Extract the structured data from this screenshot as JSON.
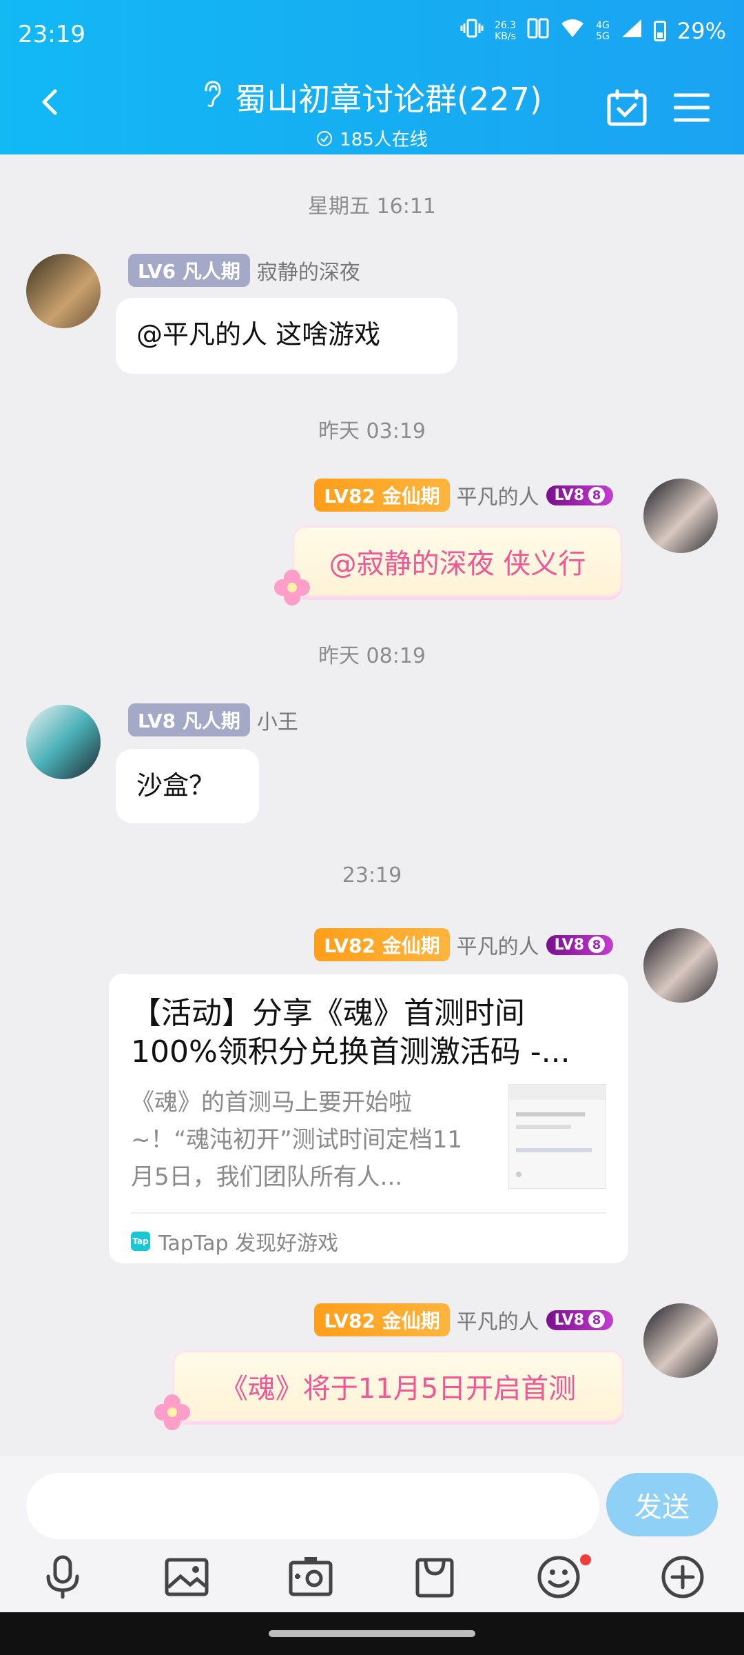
{
  "status": {
    "time": "23:19",
    "net_speed": "26.3",
    "net_unit": "KB/s",
    "net_gen_top": "4G",
    "net_gen_bottom": "5G",
    "battery": "29%"
  },
  "header": {
    "title": "蜀山初章讨论群(227)",
    "online": "185人在线"
  },
  "messages": [
    {
      "time": "星期五 16:11",
      "level": "LV6 凡人期",
      "name": "寂静的深夜",
      "text": "@平凡的人 这啥游戏"
    },
    {
      "time": "昨天 03:19",
      "level": "LV82 金仙期",
      "name": "平凡的人",
      "vip": "LV8",
      "vip_num": "8",
      "text": "@寂静的深夜 侠义行"
    },
    {
      "time": "昨天 08:19",
      "level": "LV8 凡人期",
      "name": "小王",
      "text": "沙盒？"
    },
    {
      "time": "23:19",
      "level": "LV82 金仙期",
      "name": "平凡的人",
      "vip": "LV8",
      "vip_num": "8",
      "card": {
        "title": "【活动】分享《魂》首测时间100%领积分兑换首测激活码 -...",
        "desc": "《魂》的首测马上要开始啦~！“魂沌初开”测试时间定档11月5日，我们团队所有人...",
        "source": "TapTap 发现好游戏",
        "source_logo": "Tap"
      }
    },
    {
      "level": "LV82 金仙期",
      "name": "平凡的人",
      "vip": "LV8",
      "vip_num": "8",
      "text": "《魂》将于11月5日开启首测"
    }
  ],
  "input": {
    "placeholder": "",
    "send_label": "发送"
  },
  "icons": [
    "back-icon",
    "ear-icon",
    "calendar-check-icon",
    "menu-icon",
    "microphone-icon",
    "image-icon",
    "camera-icon",
    "bag-icon",
    "emoji-icon",
    "plus-icon"
  ],
  "colors": {
    "header": "#12b9f3",
    "send": "#8fd0f7",
    "fancy_text": "#f15695",
    "badge_gold": "#ff9e1a",
    "badge_gray": "#a3a9c6"
  }
}
